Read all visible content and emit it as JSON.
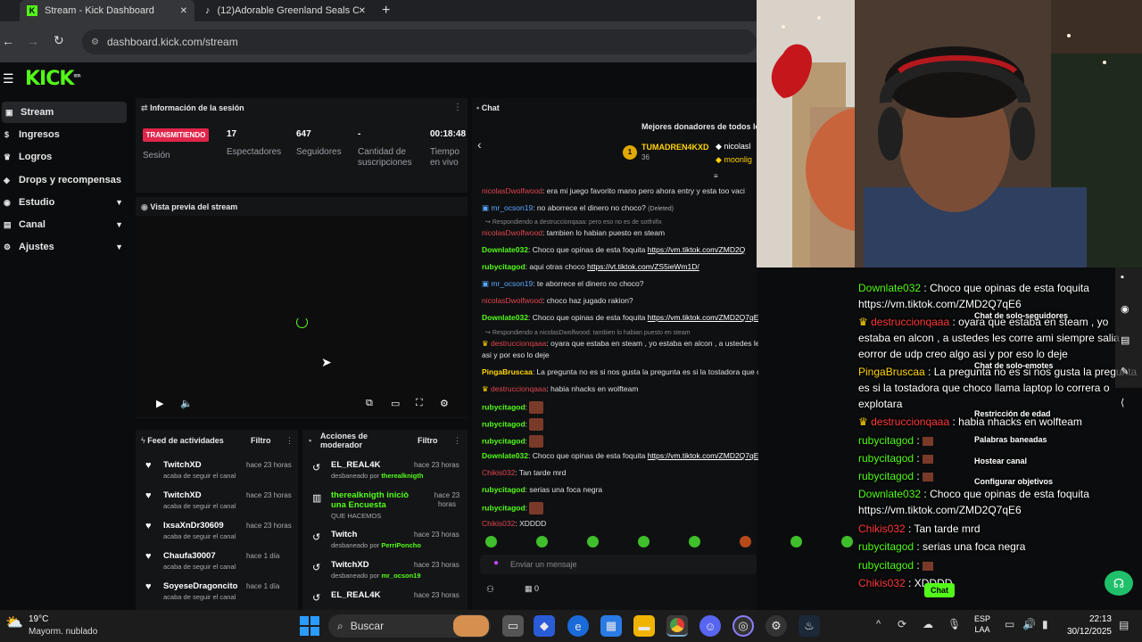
{
  "browser": {
    "tabs": [
      {
        "title": "Stream - Kick Dashboard",
        "close": "✕"
      },
      {
        "title": "(12)Adorable Greenland Seals C",
        "close": "✕"
      }
    ],
    "new_tab": "+",
    "url": "dashboard.kick.com/stream"
  },
  "kick": {
    "logo": "KICK",
    "logo_badge": "BETA",
    "sidebar": [
      {
        "label": "Stream"
      },
      {
        "label": "Ingresos"
      },
      {
        "label": "Logros"
      },
      {
        "label": "Drops y recompensas"
      },
      {
        "label": "Estudio"
      },
      {
        "label": "Canal"
      },
      {
        "label": "Ajustes"
      }
    ]
  },
  "session": {
    "title": "Información de la sesión",
    "status": "TRANSMITIENDO",
    "status_label": "Sesión",
    "stats": [
      {
        "value": "17",
        "label": "Espectadores"
      },
      {
        "value": "647",
        "label": "Seguidores"
      },
      {
        "value": "-",
        "label": "Cantidad de suscripciones"
      },
      {
        "value": "00:18:48",
        "label": "Tiempo en vivo"
      }
    ]
  },
  "preview": {
    "title": "Vista previa del stream"
  },
  "activity": {
    "title": "Feed de actividades",
    "filter": "Filtro",
    "items": [
      {
        "name": "TwitchXD",
        "sub": "acaba de seguir el canal",
        "time": "hace 23 horas"
      },
      {
        "name": "TwitchXD",
        "sub": "acaba de seguir el canal",
        "time": "hace 23 horas"
      },
      {
        "name": "IxsaXnDr30609",
        "sub": "acaba de seguir el canal",
        "time": "hace 23 horas"
      },
      {
        "name": "Chaufa30007",
        "sub": "acaba de seguir el canal",
        "time": "hace 1 día"
      },
      {
        "name": "SoyeseDragoncito",
        "sub": "acaba de seguir el canal",
        "time": "hace 1 día"
      }
    ]
  },
  "mod": {
    "title": "Acciones de moderador",
    "filter": "Filtro",
    "items": [
      {
        "name": "EL_REAL4K",
        "sub": "desbaneado por ",
        "by": "therealknigth",
        "time": "hace 23 horas"
      },
      {
        "name": "therealknigth iniciò una Encuesta",
        "sub": "QUE HACEMOS",
        "by": "",
        "time": "hace 23 horas"
      },
      {
        "name": "Twitch",
        "sub": "desbaneado por ",
        "by": "PerriPoncho",
        "time": "hace 23 horas"
      },
      {
        "name": "TwitchXD",
        "sub": "desbaneado por ",
        "by": "mr_ocson19",
        "time": "hace 23 horas"
      },
      {
        "name": "EL_REAL4K",
        "sub": "",
        "by": "",
        "time": "hace 23 horas"
      }
    ]
  },
  "chat": {
    "title": "Chat",
    "top_donors_title": "Mejores donadores de todos lo",
    "donors": [
      {
        "name": "TUMADREN4KXD",
        "amount": "36",
        "rank": "1"
      },
      {
        "name": "nicolasl"
      },
      {
        "name": "moonlig"
      }
    ],
    "messages": [
      {
        "user": "nicolasDwolfwood",
        "text": "era mi juego favorito mano pero ahora entry y esta too vaci"
      },
      {
        "user": "mr_ocson19",
        "text": "no aborrece el dinero no choco?",
        "note": "(Deleted)"
      },
      {
        "reply": "Respondiendo a destruccionqaaa: pero eso no es de sotfnifix"
      },
      {
        "user": "nicolasDwolfwood",
        "text": "tambien lo habian puesto en steam"
      },
      {
        "user": "Downlate032",
        "text": "Choco que opinas de esta foquita ",
        "link": "https://vm.tiktok.com/ZMD2Q"
      },
      {
        "user": "rubycitagod",
        "text": "aqui otras choco ",
        "link": "https://vt.tiktok.com/ZS5ieWm1D/"
      },
      {
        "user": "mr_ocson19",
        "text": "te aborrece el dinero no choco?"
      },
      {
        "user": "nicolasDwolfwood",
        "text": "choco haz jugado rakion?"
      },
      {
        "user": "Downlate032",
        "text": "Choco que opinas de esta foquita ",
        "link": "https://vm.tiktok.com/ZMD2Q7qE6"
      },
      {
        "reply": "Respondiendo a nicolasDwolfwood: tambien lo habian puesto en steam"
      },
      {
        "user": "destruccionqaaa",
        "text": "oyara que estaba en steam , yo estaba en alcon , a ustedes les corre ami siempre sala"
      },
      {
        "text": "asi y por eso lo deje"
      },
      {
        "user": "PingaBruscaa",
        "text": "La pregunta no es si nos gusta la pregunta es si la tostadora que choco llama laptop lo correra o explotara"
      },
      {
        "user": "destruccionqaaa",
        "text": "habia nhacks en wolfteam"
      },
      {
        "user": "rubycitagod",
        "text": ""
      },
      {
        "user": "rubycitagod",
        "text": ""
      },
      {
        "user": "rubycitagod",
        "text": ""
      },
      {
        "user": "Downlate032",
        "text": "Choco que opinas de esta foquita ",
        "link": "https://vm.tiktok.com/ZMD2Q7qE6"
      },
      {
        "user": "Chikis032",
        "text": "Tan tarde mrd"
      },
      {
        "user": "rubycitagod",
        "text": "serias una foca negra"
      },
      {
        "user": "rubycitagod",
        "text": ""
      },
      {
        "user": "Chikis032",
        "text": "XDDDD"
      }
    ],
    "input_placeholder": "Enviar un mensaje",
    "points": "0"
  },
  "overlay": {
    "lines": [
      {
        "user": "Downlate032",
        "text": " : Choco que opinas de esta foquita"
      },
      {
        "text": "https://vm.tiktok.com/ZMD2Q7qE6"
      },
      {
        "user": "destruccionqaaa",
        "text": " : oyara que estaba en steam , yo"
      },
      {
        "text": "estaba en alcon , a ustedes les corre ami siempre salia"
      },
      {
        "text": "eorror de udp creo algo asi y por eso lo deje"
      },
      {
        "user": "PingaBruscaa",
        "text": " : La pregunta no es si nos gusta la pregunta"
      },
      {
        "text": "es si la tostadora que choco llama laptop lo correra o"
      },
      {
        "text": "explotara"
      },
      {
        "user": "destruccionqaaa",
        "text": " : habia nhacks en wolfteam"
      },
      {
        "user": "rubycitagod",
        "text": " :"
      },
      {
        "user": "rubycitagod",
        "text": " :"
      },
      {
        "user": "rubycitagod",
        "text": " :"
      },
      {
        "user": "Downlate032",
        "text": " : Choco que opinas de esta foquita"
      },
      {
        "text": "https://vm.tiktok.com/ZMD2Q7qE6"
      },
      {
        "user": "Chikis032",
        "text": " : Tan tarde mrd"
      },
      {
        "user": "rubycitagod",
        "text": " : serias una foca negra"
      },
      {
        "user": "rubycitagod",
        "text": " :"
      },
      {
        "user": "Chikis032",
        "text": " : XDDDD"
      }
    ],
    "menu": [
      "Chat de solo-seguidores",
      "Chat de solo-emotes",
      "Restricción de edad",
      "Palabras baneadas",
      "Hostear canal",
      "Configurar objetivos"
    ],
    "chat_btn": "Chat"
  },
  "taskbar": {
    "weather_temp": "19°C",
    "weather_desc": "Mayorm. nublado",
    "search": "Buscar",
    "lang1": "ESP",
    "lang2": "LAA",
    "time": "22:13",
    "date": "30/12/2025"
  },
  "colors": {
    "kick_green": "#53fc18",
    "live_red": "#e0254a",
    "panel": "#141517"
  }
}
